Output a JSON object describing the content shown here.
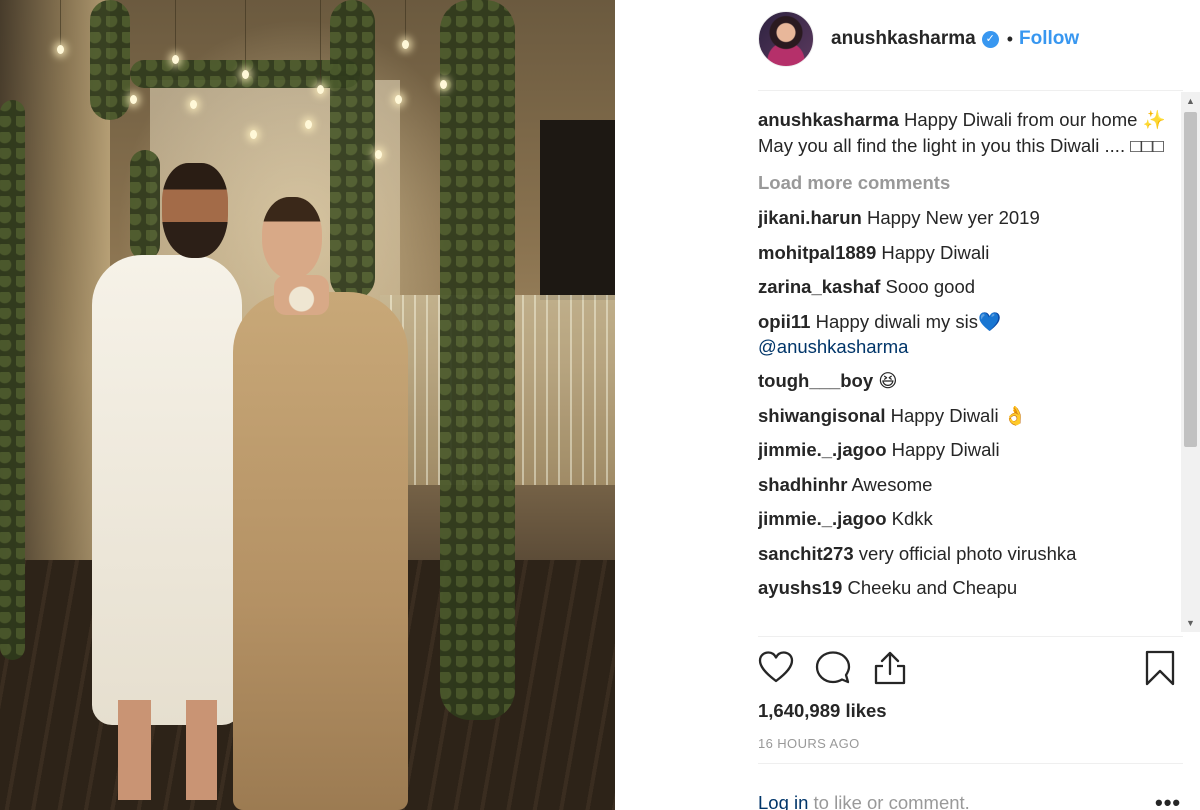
{
  "post": {
    "username": "anushkasharma",
    "verified_mark": "✓",
    "separator": "•",
    "follow_label": "Follow",
    "caption_text": " Happy Diwali from our home ✨ May you all find the light in you this Diwali .... □□□",
    "load_more_label": "Load more comments",
    "comments": [
      {
        "user": "jikani.harun",
        "text": " Happy New yer 2019"
      },
      {
        "user": "mohitpal1889",
        "text": " Happy Diwali"
      },
      {
        "user": "zarina_kashaf",
        "text": " Sooo good"
      },
      {
        "user": "opii11",
        "text": " Happy diwali my sis💙 ",
        "mention": "@anushkasharma"
      },
      {
        "user": "tough___boy",
        "text": " 😆"
      },
      {
        "user": "shiwangisonal",
        "text": " Happy Diwali 👌"
      },
      {
        "user": "jimmie._.jagoo",
        "text": " Happy Diwali"
      },
      {
        "user": "shadhinhr",
        "text": " Awesome"
      },
      {
        "user": "jimmie._.jagoo",
        "text": " Kdkk"
      },
      {
        "user": "sanchit273",
        "text": " very official photo virushka"
      },
      {
        "user": "ayushs19",
        "text": " Cheeku and Cheapu"
      }
    ],
    "likes": "1,640,989 likes",
    "time_ago": "16 HOURS AGO",
    "login_link": "Log in",
    "login_text": " to like or comment.",
    "more_label": "•••"
  },
  "icons": {
    "like": "heart-icon",
    "comment": "comment-icon",
    "share": "share-icon",
    "save": "bookmark-icon",
    "verified": "verified-badge-icon"
  },
  "colors": {
    "link_blue": "#3897f0",
    "text": "#262626",
    "muted": "#999999",
    "mention": "#003569"
  }
}
